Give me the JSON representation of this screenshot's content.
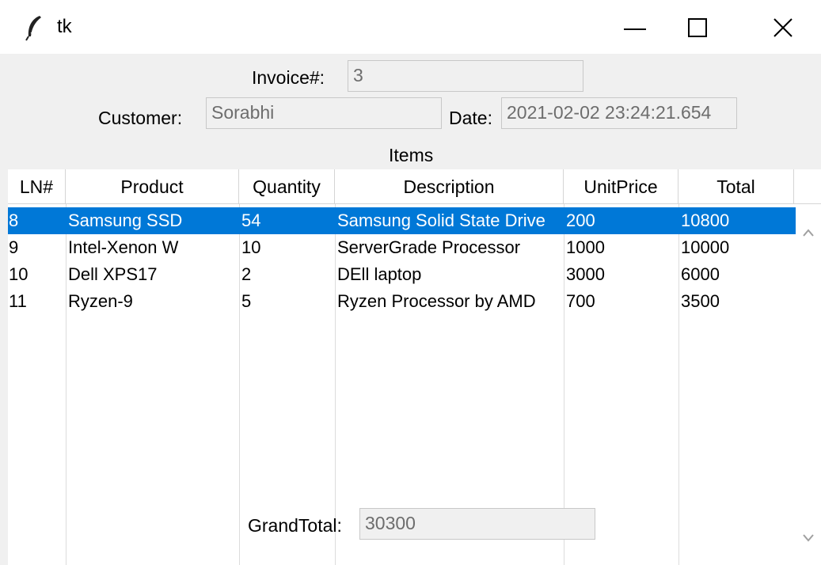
{
  "window": {
    "title": "tk",
    "icon": "feather-icon",
    "controls": [
      "minimize-icon",
      "maximize-icon",
      "close-icon"
    ]
  },
  "invoice": {
    "label": "Invoice#:",
    "value": "3"
  },
  "customer": {
    "label": "Customer:",
    "value": "Sorabhi"
  },
  "date": {
    "label": "Date:",
    "value": "2021-02-02 23:24:21.654"
  },
  "items_heading": "Items",
  "table": {
    "columns": [
      "LN#",
      "Product",
      "Quantity",
      "Description",
      "UnitPrice",
      "Total"
    ],
    "rows": [
      [
        "8",
        "Samsung SSD",
        "54",
        "Samsung Solid State Drive",
        "200",
        "10800"
      ],
      [
        "9",
        "Intel-Xenon W",
        "10",
        "ServerGrade Processor",
        "1000",
        "10000"
      ],
      [
        "10",
        "Dell XPS17",
        "2",
        "DEll laptop",
        "3000",
        "6000"
      ],
      [
        "11",
        "Ryzen-9",
        "5",
        "Ryzen Processor by AMD",
        "700",
        "3500"
      ]
    ],
    "selected_row": 0
  },
  "grand_total": {
    "label": "GrandTotal:",
    "value": "30300"
  },
  "colors": {
    "selection": "#0078d7",
    "window_bg": "#f0f0f0"
  }
}
